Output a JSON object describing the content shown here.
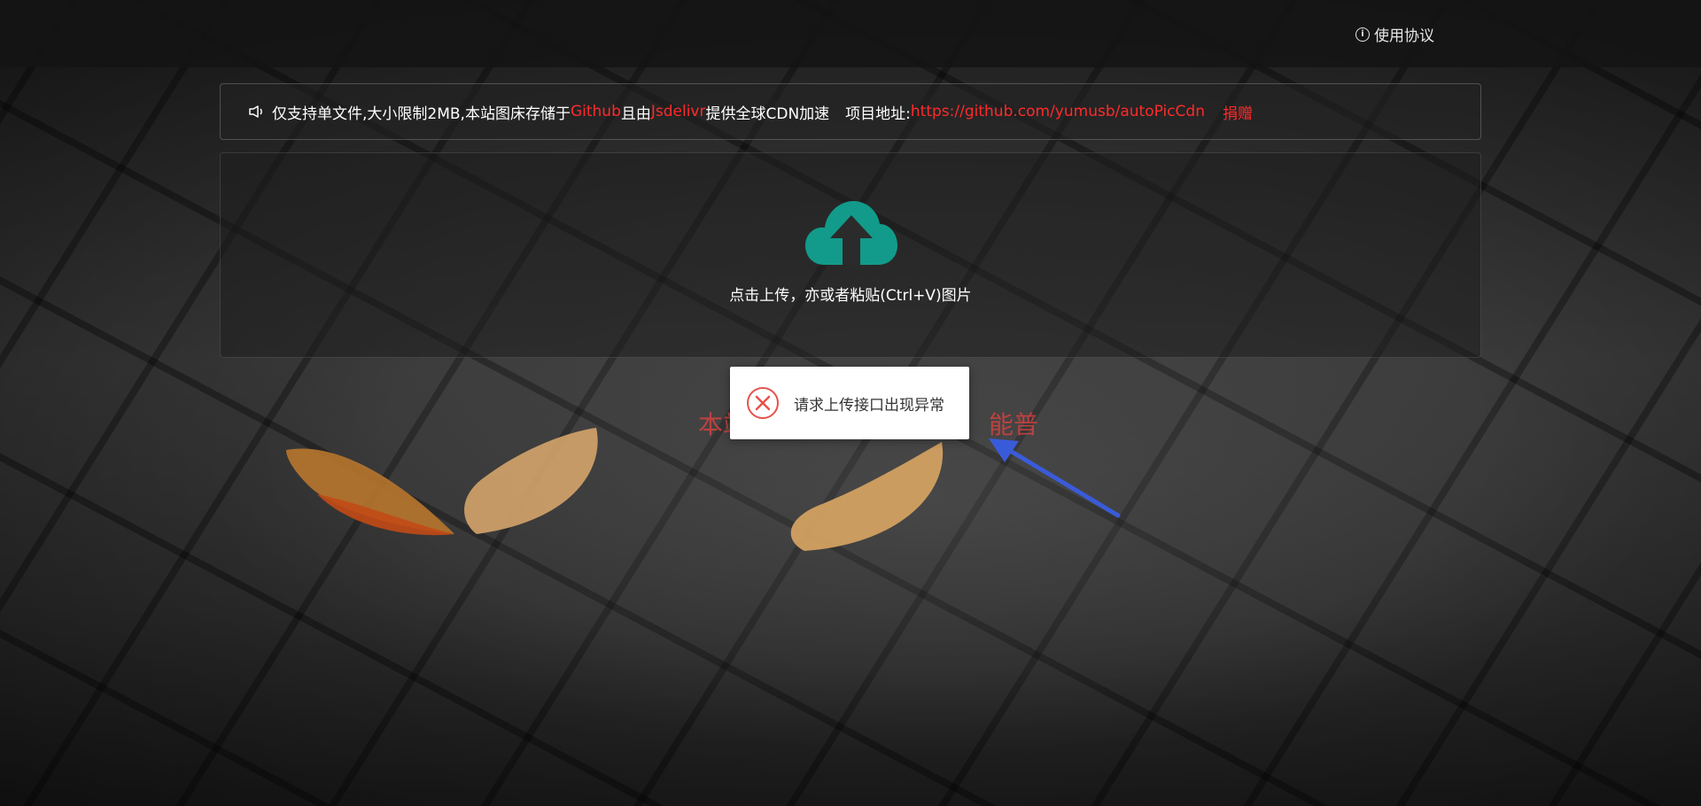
{
  "header": {
    "agreement_label": "使用协议",
    "agreement_icon": "info-icon"
  },
  "notice": {
    "icon": "speaker-icon",
    "text_1": "仅支持单文件,大小限制2MB,本站图床存储于",
    "github": "Github",
    "text_2": "且由",
    "jsdelivr": "Jsdelivr",
    "text_3": "提供全球CDN加速",
    "project_label": "项目地址:",
    "project_url": "https://github.com/yumusb/autoPicCdn",
    "donate": "捐赠"
  },
  "upload": {
    "icon": "cloud-upload-icon",
    "hint": "点击上传，亦或者粘贴(Ctrl+V)图片"
  },
  "background_text": {
    "left": "本站",
    "right": "能普"
  },
  "toast": {
    "icon": "error-icon",
    "message": "请求上传接口出现异常"
  },
  "colors": {
    "accent_teal": "#129b8a",
    "link_red": "#ff2a2a",
    "error_red": "#e8514c"
  }
}
